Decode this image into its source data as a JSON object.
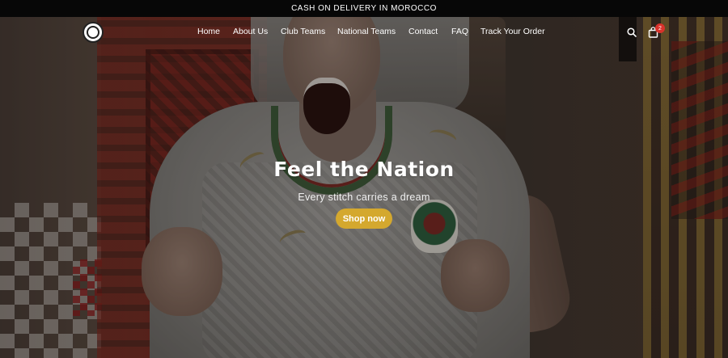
{
  "announcement": {
    "text": "CASH ON DELIVERY IN MOROCCO"
  },
  "header": {
    "logo_icon": "club-crest-logo",
    "nav": [
      {
        "label": "Home"
      },
      {
        "label": "About Us"
      },
      {
        "label": "Club Teams"
      },
      {
        "label": "National Teams"
      },
      {
        "label": "Contact"
      },
      {
        "label": "FAQ"
      },
      {
        "label": "Track Your Order"
      }
    ],
    "search_icon": "search-icon",
    "cart_icon": "shopping-bag-icon",
    "cart_count": "2"
  },
  "hero": {
    "title": "Feel the Nation",
    "subtitle": "Every stitch carries a dream",
    "cta_label": "Shop now",
    "cta_color": "#d4a82e"
  },
  "colors": {
    "announcement_bg": "#070707",
    "cart_badge": "#d9322b",
    "text": "#ffffff"
  }
}
